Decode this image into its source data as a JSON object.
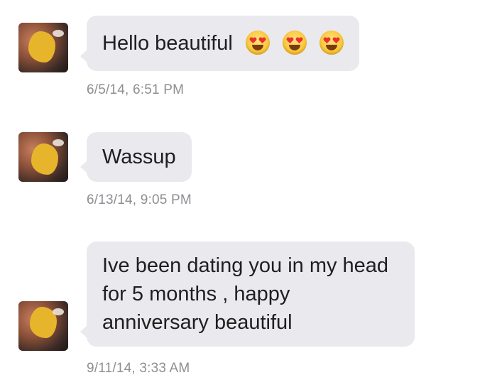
{
  "messages": [
    {
      "text": "Hello beautiful",
      "timestamp": "6/5/14, 6:51 PM",
      "emoji": [
        "heart-eyes-emoji",
        "heart-eyes-emoji",
        "heart-eyes-emoji"
      ]
    },
    {
      "text": "Wassup",
      "timestamp": "6/13/14, 9:05 PM"
    },
    {
      "text": "Ive been dating you in my head for 5 months , happy anniversary beautiful",
      "timestamp": "9/11/14, 3:33 AM"
    }
  ],
  "colors": {
    "bubble": "#e9e9ee",
    "timestamp": "#8e8e93",
    "text": "#1f1f1f"
  }
}
